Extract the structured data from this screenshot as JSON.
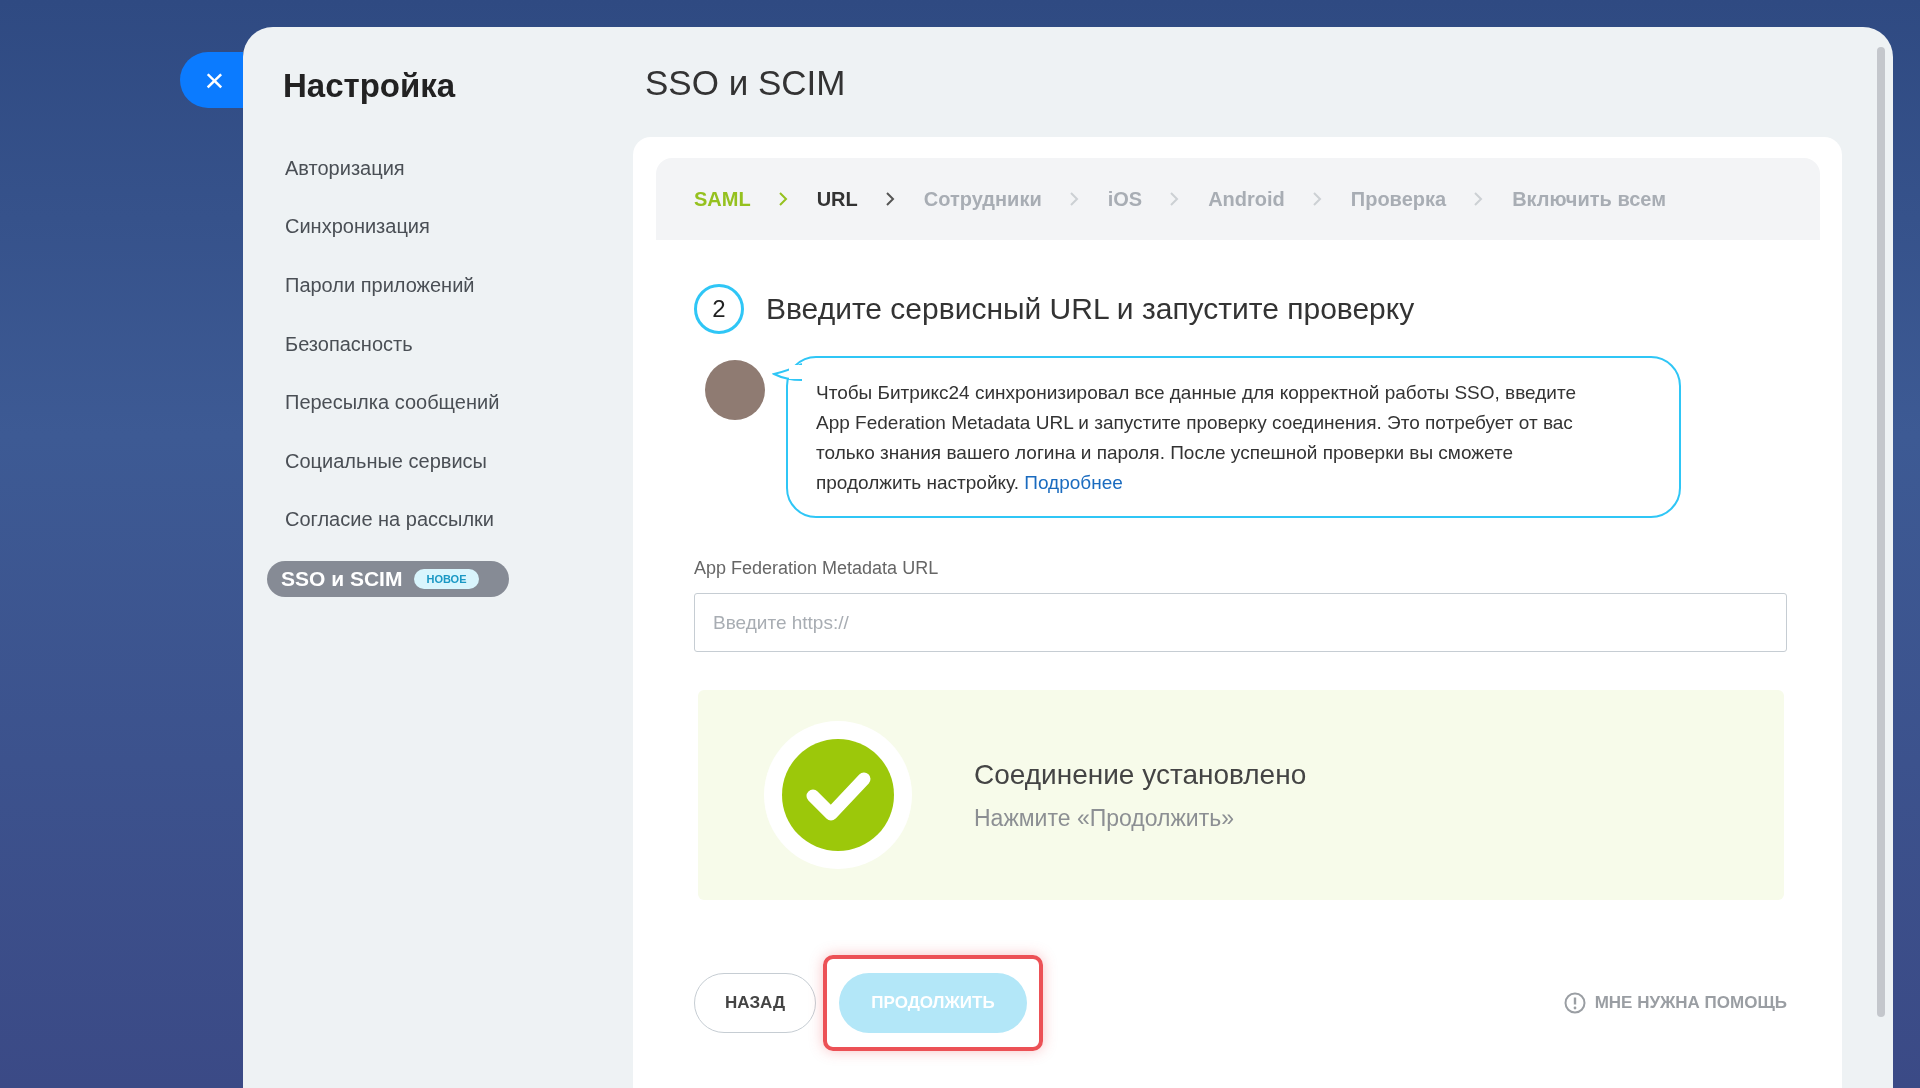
{
  "close_button": {
    "label": "×"
  },
  "sidebar": {
    "title": "Настройка",
    "items": [
      {
        "label": "Авторизация",
        "selected": false
      },
      {
        "label": "Синхронизация",
        "selected": false
      },
      {
        "label": "Пароли приложений",
        "selected": false
      },
      {
        "label": "Безопасность",
        "selected": false
      },
      {
        "label": "Пересылка сообщений",
        "selected": false
      },
      {
        "label": "Социальные сервисы",
        "selected": false
      },
      {
        "label": "Согласие на рассылки",
        "selected": false
      },
      {
        "label": "SSO и SCIM",
        "selected": true,
        "badge": "НОВОЕ"
      }
    ]
  },
  "page_title": "SSO и SCIM",
  "steps": [
    {
      "label": "SAML",
      "completed": true,
      "selected": false
    },
    {
      "label": "URL",
      "completed": false,
      "selected": true
    },
    {
      "label": "Сотрудники",
      "completed": false,
      "selected": false
    },
    {
      "label": "iOS",
      "completed": false,
      "selected": false
    },
    {
      "label": "Android",
      "completed": false,
      "selected": false
    },
    {
      "label": "Проверка",
      "completed": false,
      "selected": false
    },
    {
      "label": "Включить всем",
      "completed": false,
      "selected": false
    }
  ],
  "step_heading": {
    "number": "2",
    "title": "Введите сервисный URL и запустите проверку"
  },
  "hint": {
    "text": "Чтобы Битрикс24 синхронизировал все данные для корректной работы SSO, введите App Federation Metadata URL и запустите проверку соединения. Это потребует от вас только знания вашего логина и пароля. После успешной проверки вы сможете продолжить настройку.",
    "link": "Подробнее"
  },
  "url_field": {
    "label": "App Federation Metadata URL",
    "placeholder": "Введите https://"
  },
  "status": {
    "connected": true,
    "title": "Соединение установлено",
    "subtitle": "Нажмите «Продолжить»"
  },
  "buttons": {
    "back": {
      "label": "НАЗАД"
    },
    "continue": {
      "label": "ПРОДОЛЖИТЬ",
      "disabled": true,
      "highlighted": true
    },
    "help": {
      "label": "МНЕ НУЖНА ПОМОЩЬ"
    }
  }
}
